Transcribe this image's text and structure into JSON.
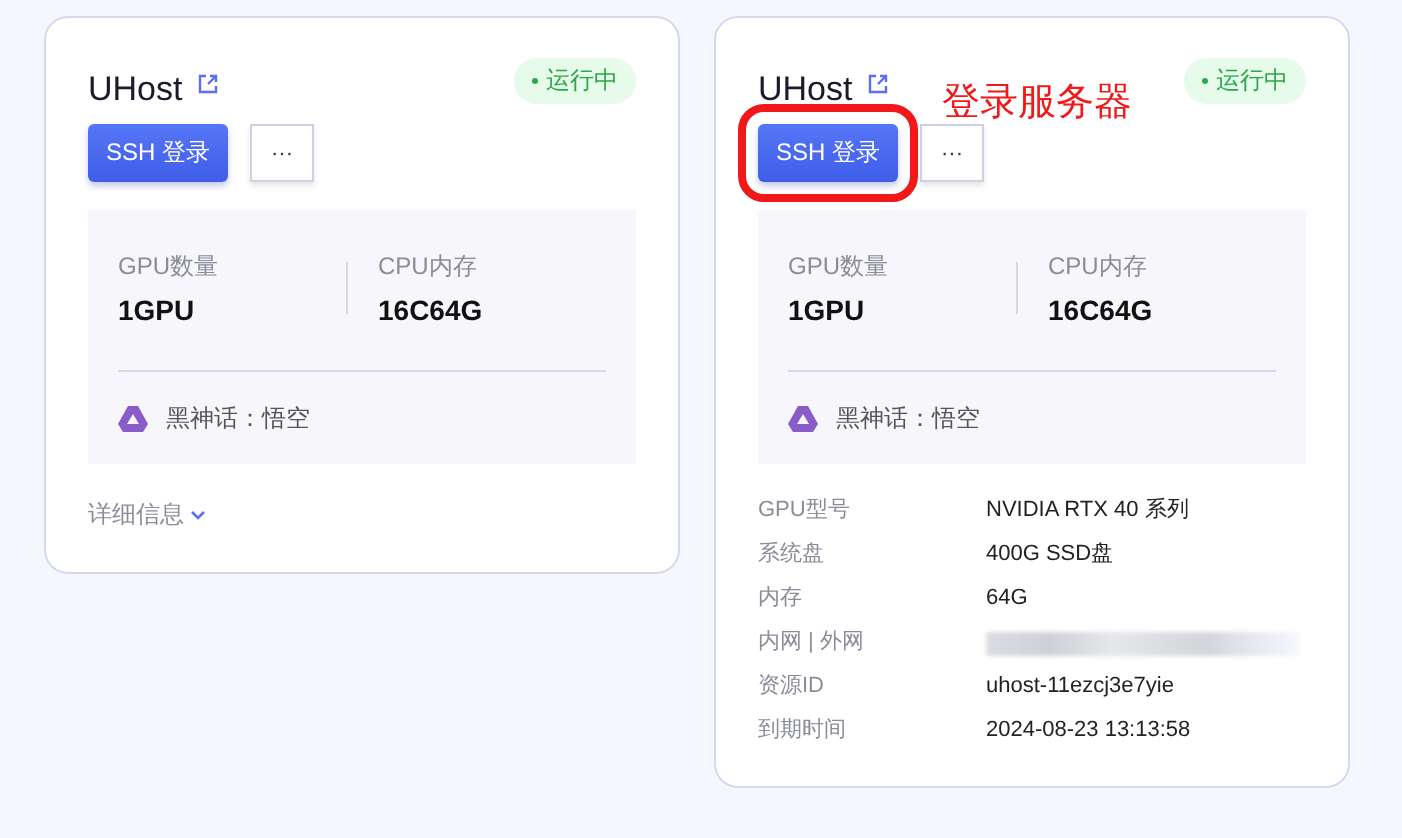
{
  "cards": [
    {
      "title": "UHost",
      "status": "运行中",
      "login_button": "SSH 登录",
      "more_button": "···",
      "specs": [
        {
          "label": "GPU数量",
          "value": "1GPU"
        },
        {
          "label": "CPU内存",
          "value": "16C64G"
        }
      ],
      "image": "黑神话：悟空",
      "details_toggle": "详细信息"
    },
    {
      "title": "UHost",
      "status": "运行中",
      "login_button": "SSH 登录",
      "more_button": "···",
      "specs": [
        {
          "label": "GPU数量",
          "value": "1GPU"
        },
        {
          "label": "CPU内存",
          "value": "16C64G"
        }
      ],
      "image": "黑神话：悟空",
      "annotation": "登录服务器",
      "details": [
        {
          "label": "GPU型号",
          "value": "NVIDIA RTX 40 系列"
        },
        {
          "label": "系统盘",
          "value": "400G SSD盘"
        },
        {
          "label": "内存",
          "value": "64G"
        },
        {
          "label": "内网 | 外网",
          "redacted": true
        },
        {
          "label": "资源ID",
          "value": "uhost-11ezcj3e7yie"
        },
        {
          "label": "到期时间",
          "value": "2024-08-23 13:13:58"
        }
      ]
    }
  ]
}
